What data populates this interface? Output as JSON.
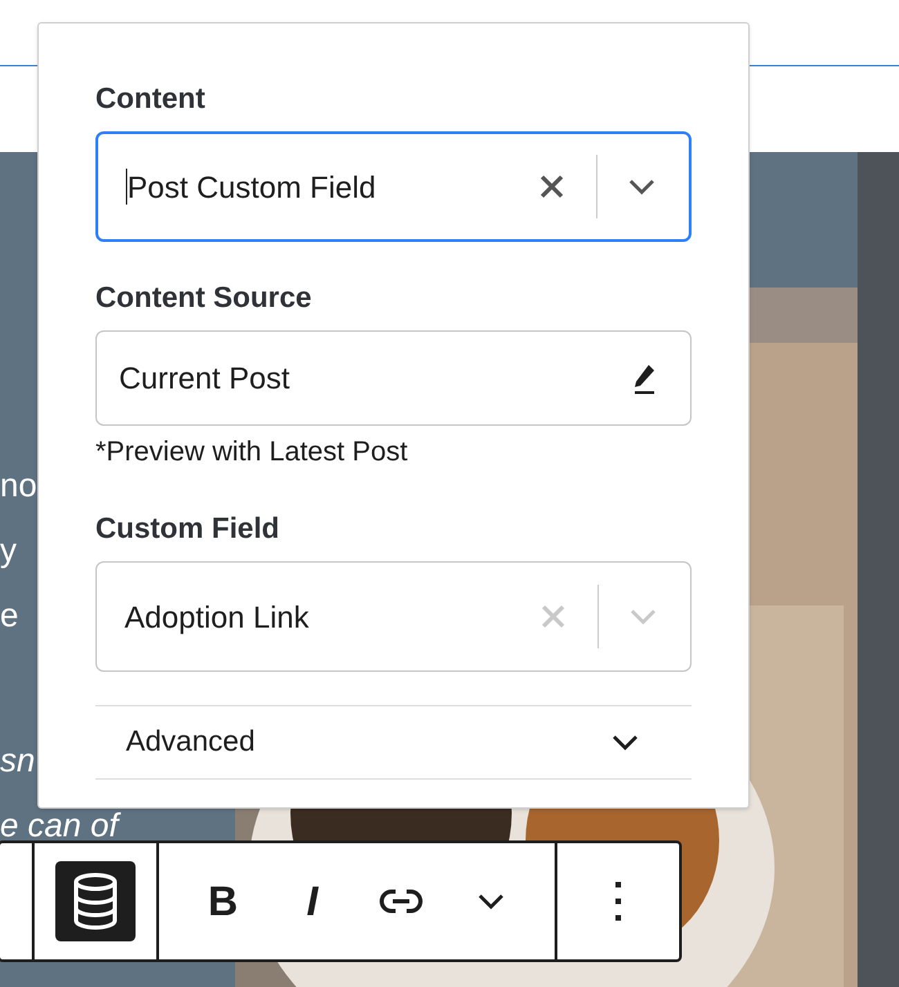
{
  "background_text": [
    {
      "text": "no",
      "italic": false
    },
    {
      "text": "y",
      "italic": false
    },
    {
      "text": "e",
      "italic": false
    },
    {
      "text": "sn",
      "italic": true
    },
    {
      "text": "e can of",
      "italic": true
    }
  ],
  "popover": {
    "fields": [
      {
        "kind": "select",
        "label": "Content",
        "value": "Post Custom Field",
        "focused": true
      },
      {
        "kind": "source",
        "label": "Content Source",
        "value": "Current Post",
        "note": "*Preview with Latest Post"
      },
      {
        "kind": "select",
        "label": "Custom Field",
        "value": "Adoption Link",
        "focused": false
      }
    ],
    "advanced": {
      "label": "Advanced",
      "expanded": false
    }
  },
  "toolbar": [
    {
      "kind": "database",
      "selected": true
    },
    {
      "kind": "text",
      "text": "B",
      "italic": false,
      "selected": false
    },
    {
      "kind": "text",
      "text": "I",
      "italic": true,
      "selected": false
    },
    {
      "kind": "link",
      "selected": false
    },
    {
      "kind": "caret",
      "selected": false
    },
    {
      "kind": "options",
      "selected": false
    }
  ]
}
